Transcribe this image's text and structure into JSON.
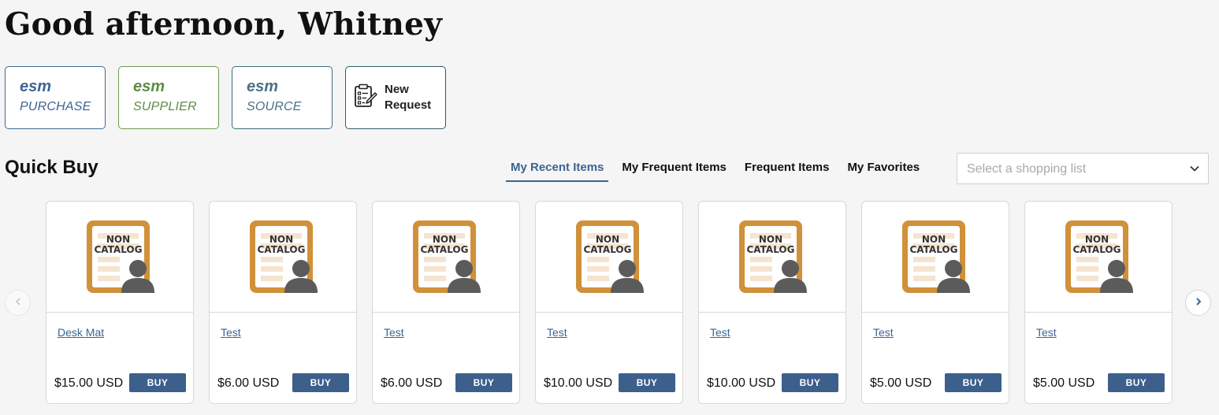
{
  "greeting": "Good afternoon, Whitney",
  "apps": [
    {
      "brand": "esm",
      "sub": "PURCHASE"
    },
    {
      "brand": "esm",
      "sub": "SUPPLIER"
    },
    {
      "brand": "esm",
      "sub": "SOURCE"
    }
  ],
  "new_request": {
    "line1": "New",
    "line2": "Request"
  },
  "quick_buy": {
    "title": "Quick Buy",
    "tabs": [
      "My Recent Items",
      "My Frequent Items",
      "Frequent Items",
      "My Favorites"
    ],
    "active_tab": "My Recent Items",
    "shopping_list": {
      "placeholder": "Select a shopping list"
    }
  },
  "product_image": {
    "line1": "NON",
    "line2": "CATALOG"
  },
  "items": [
    {
      "name": "Desk Mat",
      "price": "$15.00 USD",
      "buy": "BUY"
    },
    {
      "name": "Test",
      "price": "$6.00 USD",
      "buy": "BUY"
    },
    {
      "name": "Test",
      "price": "$6.00 USD",
      "buy": "BUY"
    },
    {
      "name": "Test",
      "price": "$10.00 USD",
      "buy": "BUY"
    },
    {
      "name": "Test",
      "price": "$10.00 USD",
      "buy": "BUY"
    },
    {
      "name": "Test",
      "price": "$5.00 USD",
      "buy": "BUY"
    },
    {
      "name": "Test",
      "price": "$5.00 USD",
      "buy": "BUY"
    }
  ],
  "colors": {
    "accent": "#3d6494",
    "supplier": "#5d8c43",
    "source": "#4a7186",
    "buy_button": "#3c5f8c",
    "doc_icon": "#d0913a"
  }
}
